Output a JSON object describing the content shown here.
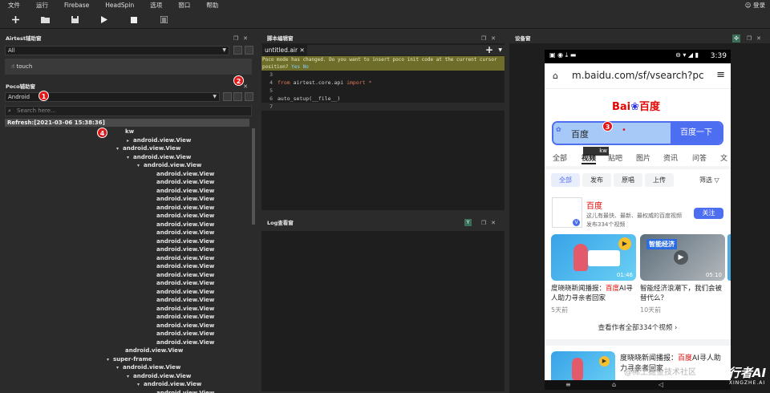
{
  "menu": {
    "items": [
      "文件",
      "运行",
      "Firebase",
      "HeadSpin",
      "选项",
      "窗口",
      "帮助"
    ],
    "login": "登录"
  },
  "airtest_panel": {
    "title": "Airtest辅助窗",
    "filter_value": "All",
    "item": "touch"
  },
  "poco_panel": {
    "title": "Poco辅助窗",
    "mode": "Android",
    "search_placeholder": "Search here...",
    "refresh": "Refresh:[2021-03-06 15:38:36]"
  },
  "tree": [
    {
      "label": "kw",
      "indent": 1,
      "toggle": ""
    },
    {
      "label": "android.view.View",
      "indent": 2,
      "toggle": "▸"
    },
    {
      "label": "android.view.View",
      "indent": 1,
      "toggle": "▾"
    },
    {
      "label": "android.view.View",
      "indent": 2,
      "toggle": "▾"
    },
    {
      "label": "android.view.View",
      "indent": 3,
      "toggle": "▾"
    },
    {
      "label": "android.view.View",
      "indent": 4,
      "toggle": ""
    },
    {
      "label": "android.view.View",
      "indent": 4,
      "toggle": ""
    },
    {
      "label": "android.view.View",
      "indent": 4,
      "toggle": ""
    },
    {
      "label": "android.view.View",
      "indent": 4,
      "toggle": ""
    },
    {
      "label": "android.view.View",
      "indent": 4,
      "toggle": ""
    },
    {
      "label": "android.view.View",
      "indent": 4,
      "toggle": ""
    },
    {
      "label": "android.view.View",
      "indent": 4,
      "toggle": ""
    },
    {
      "label": "android.view.View",
      "indent": 4,
      "toggle": ""
    },
    {
      "label": "android.view.View",
      "indent": 4,
      "toggle": ""
    },
    {
      "label": "android.view.View",
      "indent": 4,
      "toggle": ""
    },
    {
      "label": "android.view.View",
      "indent": 4,
      "toggle": ""
    },
    {
      "label": "android.view.View",
      "indent": 4,
      "toggle": ""
    },
    {
      "label": "android.view.View",
      "indent": 4,
      "toggle": ""
    },
    {
      "label": "android.view.View",
      "indent": 4,
      "toggle": ""
    },
    {
      "label": "android.view.View",
      "indent": 4,
      "toggle": ""
    },
    {
      "label": "android.view.View",
      "indent": 4,
      "toggle": ""
    },
    {
      "label": "android.view.View",
      "indent": 4,
      "toggle": ""
    },
    {
      "label": "android.view.View",
      "indent": 4,
      "toggle": ""
    },
    {
      "label": "android.view.View",
      "indent": 4,
      "toggle": ""
    },
    {
      "label": "android.view.View",
      "indent": 4,
      "toggle": ""
    },
    {
      "label": "android.view.View",
      "indent": 4,
      "toggle": ""
    },
    {
      "label": "android.view.View",
      "indent": 1,
      "toggle": ""
    },
    {
      "label": "super-frame",
      "indent": 0,
      "toggle": "▾"
    },
    {
      "label": "android.view.View",
      "indent": 1,
      "toggle": "▾"
    },
    {
      "label": "android.view.View",
      "indent": 2,
      "toggle": "▾"
    },
    {
      "label": "android.view.View",
      "indent": 3,
      "toggle": "▾"
    },
    {
      "label": "android.view.View",
      "indent": 4,
      "toggle": ""
    }
  ],
  "editor": {
    "title": "脚本编辑窗",
    "tab": "untitled.air",
    "banner_text": "Poco mode has changed. Do you want to insert poco init code at the current cursor position?",
    "banner_yes": "Yes",
    "banner_no": "No",
    "lines": [
      {
        "n": "3",
        "code": ""
      },
      {
        "n": "4",
        "code": "from airtest.core.api import *"
      },
      {
        "n": "5",
        "code": ""
      },
      {
        "n": "6",
        "code": "auto_setup(__file__)"
      },
      {
        "n": "7",
        "code": ""
      }
    ]
  },
  "log": {
    "title": "Log查看窗"
  },
  "device_panel": {
    "title": "设备窗"
  },
  "phone": {
    "time": "3:39",
    "url": "m.baidu.com/sf/vsearch?pc",
    "search_text": "百度",
    "search_button": "百度一下",
    "kw_tooltip": "kw",
    "tabs": [
      "全部",
      "视频",
      "贴吧",
      "图片",
      "资讯",
      "问答",
      "文"
    ],
    "chips": [
      "全部",
      "发布",
      "原唱",
      "上传",
      "筛选"
    ],
    "author_name": "百度",
    "author_desc": "这儿有最快、最新、最权威的百度视频",
    "author_count": "发布334个视频",
    "follow": "关注",
    "video1_title": "度晓晓新闻播报：",
    "video1_red": "百度",
    "video1_title2": "AI寻人助力寻亲者回家",
    "video1_dur": "01:46",
    "video1_ago": "5天前",
    "video2_title": "智能经济浪潮下，我们会被替代么？",
    "video2_dur": "05:10",
    "video2_ago": "10天前",
    "video2_caption": "智能经济",
    "more": "查看作者全部334个视频",
    "video3_title": "度晓晓新闻播报：",
    "video3_red": "百度",
    "video3_title2": "AI寻人助力寻亲者回家",
    "watermark": "@稀土掘金技术社区",
    "logo_text": "行者AI",
    "logo_sub": "XINGZHE.AI"
  },
  "badges": [
    "1",
    "2",
    "3",
    "4"
  ],
  "colors": {
    "accent": "#2a64f0",
    "badge": "#e01818",
    "banner": "#6e6e2a"
  }
}
